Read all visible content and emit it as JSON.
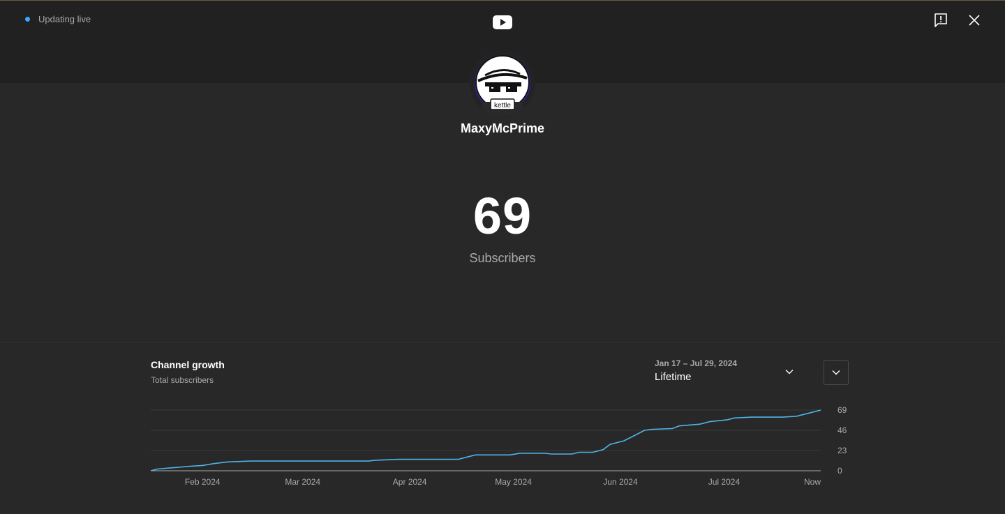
{
  "header": {
    "live_label": "Updating live",
    "logo_icon": "youtube-play-icon",
    "feedback_icon": "feedback-icon",
    "close_icon": "close-icon"
  },
  "channel": {
    "name": "MaxyMcPrime",
    "avatar_text": "kettle",
    "subscriber_count": "69",
    "subscriber_label": "Subscribers"
  },
  "growth": {
    "title": "Channel growth",
    "subtitle": "Total subscribers",
    "range_dates": "Jan 17 – Jul 29, 2024",
    "range_value": "Lifetime"
  },
  "colors": {
    "accent": "#3ea6ff",
    "line": "#4fb3e8",
    "background": "#282828",
    "header": "#212121"
  },
  "chart_data": {
    "type": "line",
    "title": "Channel growth",
    "subtitle": "Total subscribers",
    "x_tick_labels": [
      "Feb 2024",
      "Mar 2024",
      "Apr 2024",
      "May 2024",
      "Jun 2024",
      "Jul 2024",
      "Now"
    ],
    "y_tick_labels": [
      "0",
      "23",
      "46",
      "69"
    ],
    "ylim": [
      0,
      69
    ],
    "xlim": [
      "2024-01-17",
      "2024-07-29"
    ],
    "grid": true,
    "series": [
      {
        "values": [
          [
            "2024-01-17",
            0
          ],
          [
            "2024-01-19",
            2
          ],
          [
            "2024-01-22",
            3
          ],
          [
            "2024-01-25",
            4
          ],
          [
            "2024-01-28",
            5
          ],
          [
            "2024-02-01",
            6
          ],
          [
            "2024-02-04",
            8
          ],
          [
            "2024-02-08",
            10
          ],
          [
            "2024-02-15",
            11
          ],
          [
            "2024-03-01",
            11
          ],
          [
            "2024-03-20",
            11
          ],
          [
            "2024-03-22",
            12
          ],
          [
            "2024-03-29",
            13
          ],
          [
            "2024-04-15",
            13
          ],
          [
            "2024-04-18",
            16
          ],
          [
            "2024-04-20",
            18
          ],
          [
            "2024-04-30",
            18
          ],
          [
            "2024-05-03",
            20
          ],
          [
            "2024-05-10",
            20
          ],
          [
            "2024-05-12",
            19
          ],
          [
            "2024-05-18",
            19
          ],
          [
            "2024-05-20",
            21
          ],
          [
            "2024-05-24",
            21
          ],
          [
            "2024-05-27",
            24
          ],
          [
            "2024-05-29",
            30
          ],
          [
            "2024-06-02",
            34
          ],
          [
            "2024-06-05",
            40
          ],
          [
            "2024-06-08",
            46
          ],
          [
            "2024-06-10",
            47
          ],
          [
            "2024-06-16",
            48
          ],
          [
            "2024-06-18",
            51
          ],
          [
            "2024-06-24",
            53
          ],
          [
            "2024-06-27",
            56
          ],
          [
            "2024-07-02",
            58
          ],
          [
            "2024-07-04",
            60
          ],
          [
            "2024-07-09",
            61
          ],
          [
            "2024-07-14",
            61
          ],
          [
            "2024-07-18",
            61
          ],
          [
            "2024-07-22",
            62
          ],
          [
            "2024-07-24",
            64
          ],
          [
            "2024-07-26",
            66
          ],
          [
            "2024-07-29",
            69
          ]
        ]
      }
    ]
  }
}
